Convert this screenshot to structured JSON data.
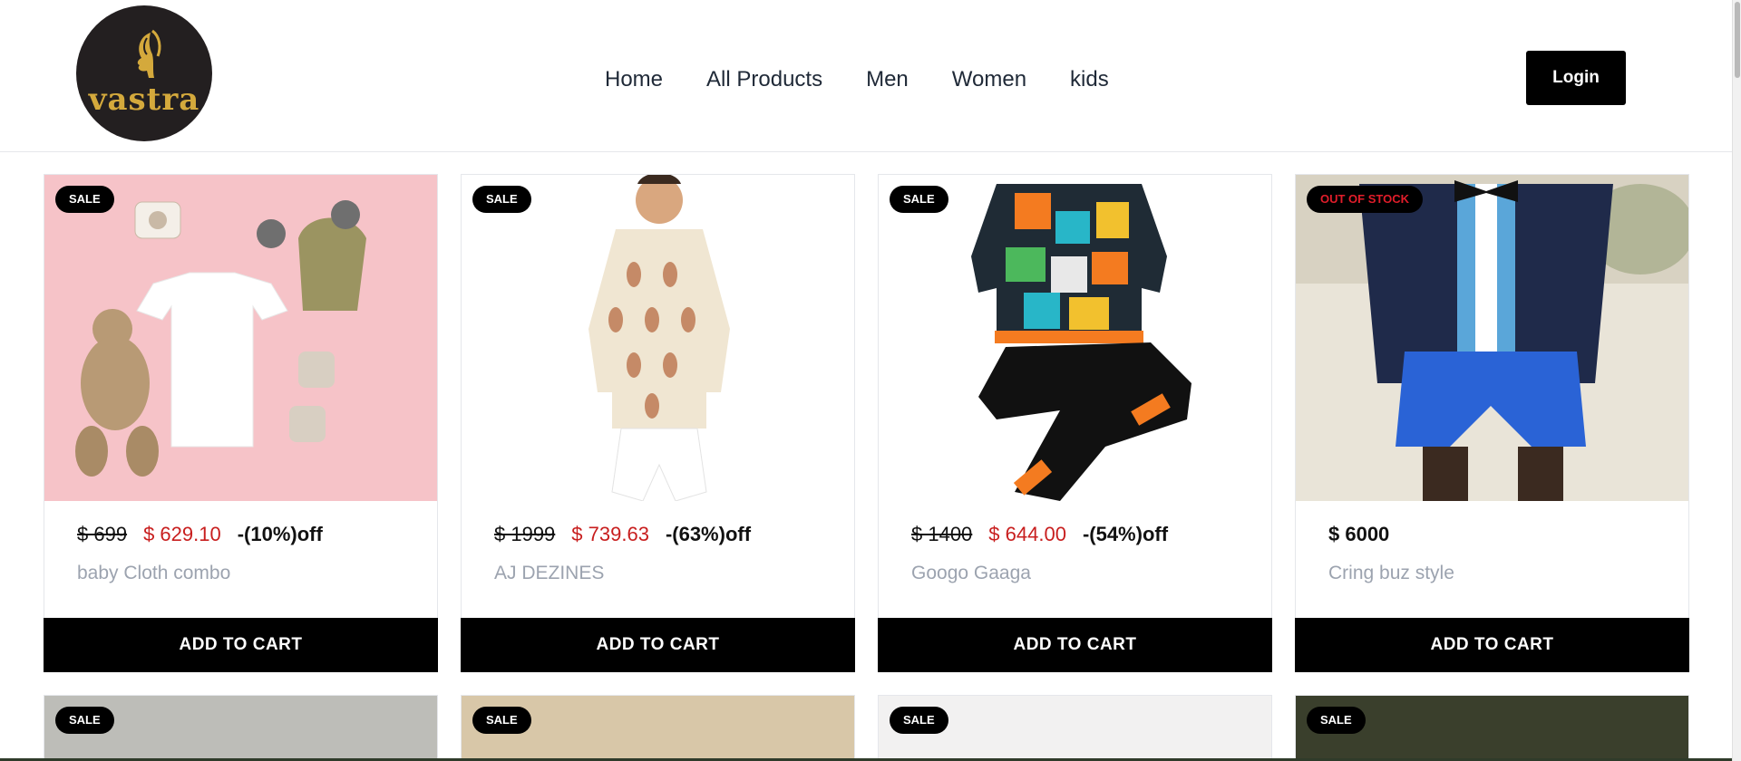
{
  "brand": {
    "logo_text": "vastra"
  },
  "nav": {
    "items": [
      "Home",
      "All Products",
      "Men",
      "Women",
      "kids"
    ]
  },
  "header": {
    "login_label": "Login"
  },
  "products": [
    {
      "badge": "SALE",
      "old_price": "$ 699",
      "new_price": "$ 629.10",
      "discount": "-(10%)off",
      "name": "baby Cloth combo",
      "cart_label": "ADD TO CART"
    },
    {
      "badge": "SALE",
      "old_price": "$ 1999",
      "new_price": "$ 739.63",
      "discount": "-(63%)off",
      "name": "AJ DEZINES",
      "cart_label": "ADD TO CART"
    },
    {
      "badge": "SALE",
      "old_price": "$ 1400",
      "new_price": "$ 644.00",
      "discount": "-(54%)off",
      "name": "Googo Gaaga",
      "cart_label": "ADD TO CART"
    },
    {
      "badge": "OUT OF STOCK",
      "price": "$ 6000",
      "name": "Cring buz style",
      "cart_label": "ADD TO CART"
    }
  ],
  "row2_badges": [
    "SALE",
    "SALE",
    "SALE",
    "SALE"
  ],
  "colors": {
    "sale_price": "#c81e1e",
    "out_of_stock": "#e11d2a",
    "button": "#000000",
    "logo_gold": "#d4a93c"
  }
}
